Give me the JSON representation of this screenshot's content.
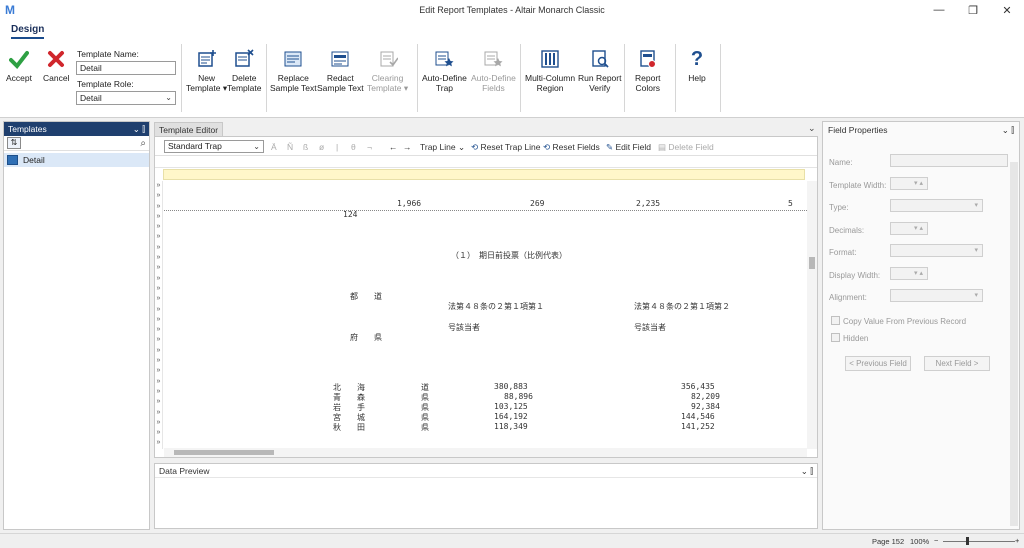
{
  "window": {
    "title": "Edit Report Templates - Altair Monarch Classic",
    "logo": "M"
  },
  "ribbon": {
    "tab": "Design",
    "accept": "Accept",
    "cancel": "Cancel",
    "template_name_label": "Template Name:",
    "template_name_value": "Detail",
    "template_role_label": "Template Role:",
    "template_role_value": "Detail",
    "new_template": [
      "New",
      "Template"
    ],
    "delete_template": [
      "Delete",
      "Template"
    ],
    "replace_sample": [
      "Replace",
      "Sample Text"
    ],
    "redact_sample": [
      "Redact",
      "Sample Text"
    ],
    "clearing_template": [
      "Clearing",
      "Template"
    ],
    "auto_define_trap": [
      "Auto-Define",
      "Trap"
    ],
    "auto_define_fields": [
      "Auto-Define",
      "Fields"
    ],
    "multi_column": [
      "Multi-Column",
      "Region"
    ],
    "run_report_verify": [
      "Run Report",
      "Verify"
    ],
    "report_colors": [
      "Report",
      "Colors"
    ],
    "help": "Help"
  },
  "templates_pane": {
    "title": "Templates",
    "items": [
      "Detail"
    ]
  },
  "editor": {
    "tab": "Template Editor",
    "trap_type": "Standard Trap",
    "toolbar_glyphs": [
      "Ä",
      "Ñ",
      "ß",
      "ø",
      "|",
      "θ",
      "¬"
    ],
    "trap_line": "Trap Line",
    "reset_trap_line": "Reset Trap Line",
    "reset_fields": "Reset Fields",
    "edit_field": "Edit Field",
    "delete_field": "Delete Field",
    "lines": [
      "1,966",
      "269",
      "2,235",
      "5",
      "124",
      "（１）　期日前投票（比例代表）",
      "都　　道",
      "法第４８条の２第１項第１",
      "法第４８条の２第１項第２",
      "号該当者",
      "号該当者",
      "府　　県"
    ],
    "rows": [
      {
        "pref": "北　　海",
        "suffix": "道",
        "v1": "380,883",
        "v2": "356,435"
      },
      {
        "pref": "青　　森",
        "suffix": "県",
        "v1": "88,896",
        "v2": "82,209"
      },
      {
        "pref": "岩　　手",
        "suffix": "県",
        "v1": "103,125",
        "v2": "92,384"
      },
      {
        "pref": "宮　　城",
        "suffix": "県",
        "v1": "164,192",
        "v2": "144,546"
      },
      {
        "pref": "秋　　田",
        "suffix": "県",
        "v1": "118,349",
        "v2": "141,252"
      }
    ]
  },
  "data_preview": {
    "title": "Data Preview"
  },
  "field_properties": {
    "title": "Field Properties",
    "name": "Name:",
    "template_width": "Template Width:",
    "type": "Type:",
    "decimals": "Decimals:",
    "format": "Format:",
    "display_width": "Display Width:",
    "alignment": "Alignment:",
    "copy_value": "Copy Value From Previous Record",
    "hidden": "Hidden",
    "previous_field": "< Previous Field",
    "next_field": "Next Field >"
  },
  "status": {
    "page": "Page 152",
    "zoom": "100%"
  },
  "colors": {
    "accept_green": "#2ea043",
    "cancel_red": "#d0262c",
    "ribbon_blue": "#1f4f8f",
    "pane_header": "#1f3f6e"
  }
}
